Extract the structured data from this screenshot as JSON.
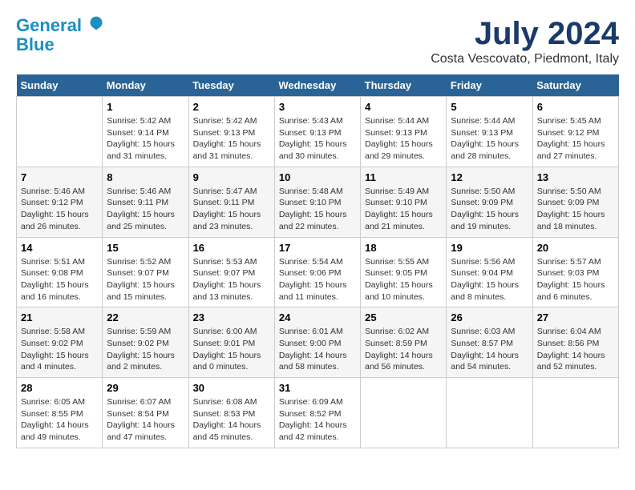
{
  "logo": {
    "line1": "General",
    "line2": "Blue"
  },
  "title": "July 2024",
  "location": "Costa Vescovato, Piedmont, Italy",
  "weekdays": [
    "Sunday",
    "Monday",
    "Tuesday",
    "Wednesday",
    "Thursday",
    "Friday",
    "Saturday"
  ],
  "weeks": [
    [
      {
        "day": "",
        "info": ""
      },
      {
        "day": "1",
        "info": "Sunrise: 5:42 AM\nSunset: 9:14 PM\nDaylight: 15 hours\nand 31 minutes."
      },
      {
        "day": "2",
        "info": "Sunrise: 5:42 AM\nSunset: 9:13 PM\nDaylight: 15 hours\nand 31 minutes."
      },
      {
        "day": "3",
        "info": "Sunrise: 5:43 AM\nSunset: 9:13 PM\nDaylight: 15 hours\nand 30 minutes."
      },
      {
        "day": "4",
        "info": "Sunrise: 5:44 AM\nSunset: 9:13 PM\nDaylight: 15 hours\nand 29 minutes."
      },
      {
        "day": "5",
        "info": "Sunrise: 5:44 AM\nSunset: 9:13 PM\nDaylight: 15 hours\nand 28 minutes."
      },
      {
        "day": "6",
        "info": "Sunrise: 5:45 AM\nSunset: 9:12 PM\nDaylight: 15 hours\nand 27 minutes."
      }
    ],
    [
      {
        "day": "7",
        "info": "Sunrise: 5:46 AM\nSunset: 9:12 PM\nDaylight: 15 hours\nand 26 minutes."
      },
      {
        "day": "8",
        "info": "Sunrise: 5:46 AM\nSunset: 9:11 PM\nDaylight: 15 hours\nand 25 minutes."
      },
      {
        "day": "9",
        "info": "Sunrise: 5:47 AM\nSunset: 9:11 PM\nDaylight: 15 hours\nand 23 minutes."
      },
      {
        "day": "10",
        "info": "Sunrise: 5:48 AM\nSunset: 9:10 PM\nDaylight: 15 hours\nand 22 minutes."
      },
      {
        "day": "11",
        "info": "Sunrise: 5:49 AM\nSunset: 9:10 PM\nDaylight: 15 hours\nand 21 minutes."
      },
      {
        "day": "12",
        "info": "Sunrise: 5:50 AM\nSunset: 9:09 PM\nDaylight: 15 hours\nand 19 minutes."
      },
      {
        "day": "13",
        "info": "Sunrise: 5:50 AM\nSunset: 9:09 PM\nDaylight: 15 hours\nand 18 minutes."
      }
    ],
    [
      {
        "day": "14",
        "info": "Sunrise: 5:51 AM\nSunset: 9:08 PM\nDaylight: 15 hours\nand 16 minutes."
      },
      {
        "day": "15",
        "info": "Sunrise: 5:52 AM\nSunset: 9:07 PM\nDaylight: 15 hours\nand 15 minutes."
      },
      {
        "day": "16",
        "info": "Sunrise: 5:53 AM\nSunset: 9:07 PM\nDaylight: 15 hours\nand 13 minutes."
      },
      {
        "day": "17",
        "info": "Sunrise: 5:54 AM\nSunset: 9:06 PM\nDaylight: 15 hours\nand 11 minutes."
      },
      {
        "day": "18",
        "info": "Sunrise: 5:55 AM\nSunset: 9:05 PM\nDaylight: 15 hours\nand 10 minutes."
      },
      {
        "day": "19",
        "info": "Sunrise: 5:56 AM\nSunset: 9:04 PM\nDaylight: 15 hours\nand 8 minutes."
      },
      {
        "day": "20",
        "info": "Sunrise: 5:57 AM\nSunset: 9:03 PM\nDaylight: 15 hours\nand 6 minutes."
      }
    ],
    [
      {
        "day": "21",
        "info": "Sunrise: 5:58 AM\nSunset: 9:02 PM\nDaylight: 15 hours\nand 4 minutes."
      },
      {
        "day": "22",
        "info": "Sunrise: 5:59 AM\nSunset: 9:02 PM\nDaylight: 15 hours\nand 2 minutes."
      },
      {
        "day": "23",
        "info": "Sunrise: 6:00 AM\nSunset: 9:01 PM\nDaylight: 15 hours\nand 0 minutes."
      },
      {
        "day": "24",
        "info": "Sunrise: 6:01 AM\nSunset: 9:00 PM\nDaylight: 14 hours\nand 58 minutes."
      },
      {
        "day": "25",
        "info": "Sunrise: 6:02 AM\nSunset: 8:59 PM\nDaylight: 14 hours\nand 56 minutes."
      },
      {
        "day": "26",
        "info": "Sunrise: 6:03 AM\nSunset: 8:57 PM\nDaylight: 14 hours\nand 54 minutes."
      },
      {
        "day": "27",
        "info": "Sunrise: 6:04 AM\nSunset: 8:56 PM\nDaylight: 14 hours\nand 52 minutes."
      }
    ],
    [
      {
        "day": "28",
        "info": "Sunrise: 6:05 AM\nSunset: 8:55 PM\nDaylight: 14 hours\nand 49 minutes."
      },
      {
        "day": "29",
        "info": "Sunrise: 6:07 AM\nSunset: 8:54 PM\nDaylight: 14 hours\nand 47 minutes."
      },
      {
        "day": "30",
        "info": "Sunrise: 6:08 AM\nSunset: 8:53 PM\nDaylight: 14 hours\nand 45 minutes."
      },
      {
        "day": "31",
        "info": "Sunrise: 6:09 AM\nSunset: 8:52 PM\nDaylight: 14 hours\nand 42 minutes."
      },
      {
        "day": "",
        "info": ""
      },
      {
        "day": "",
        "info": ""
      },
      {
        "day": "",
        "info": ""
      }
    ]
  ]
}
